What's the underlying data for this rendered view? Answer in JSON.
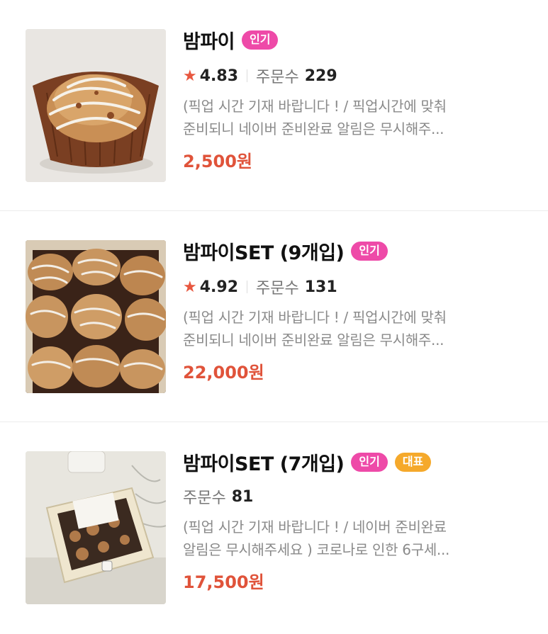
{
  "products": [
    {
      "title": "밤파이",
      "badges": [
        {
          "text": "인기",
          "color": "#ee4aa8"
        }
      ],
      "rating": "4.83",
      "orders_label": "주문수",
      "orders_count": "229",
      "desc_line1": "(픽업 시간 기재 바랍니다 ! / 픽업시간에 맞춰",
      "desc_line2": "준비되니 네이버 준비완료 알림은 무시해주...",
      "price": "2,500원"
    },
    {
      "title": "밤파이SET (9개입)",
      "badges": [
        {
          "text": "인기",
          "color": "#ee4aa8"
        }
      ],
      "rating": "4.92",
      "orders_label": "주문수",
      "orders_count": "131",
      "desc_line1": "(픽업 시간 기재 바랍니다 ! / 픽업시간에 맞춰",
      "desc_line2": "준비되니 네이버 준비완료 알림은 무시해주...",
      "price": "22,000원"
    },
    {
      "title": "밤파이SET (7개입)",
      "badges": [
        {
          "text": "인기",
          "color": "#ee4aa8"
        },
        {
          "text": "대표",
          "color": "#f5a92b"
        }
      ],
      "orders_label": "주문수",
      "orders_count": "81",
      "desc_line1": "(픽업 시간 기재 바랍니다 ! / 네이버 준비완료",
      "desc_line2": "알림은 무시해주세요 ) 코로나로 인한 6구세...",
      "price": "17,500원"
    }
  ],
  "accent_price_color": "#e0533a",
  "star_icon": "★"
}
